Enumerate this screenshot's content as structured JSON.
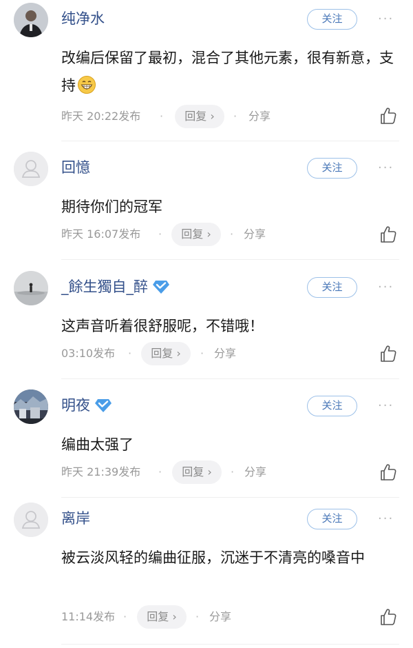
{
  "follow_label": "关注",
  "more_glyph": "···",
  "share_label": "分享",
  "dot": "·",
  "colors": {
    "username": "#33508a",
    "follow_border": "#9cc0e8",
    "follow_text": "#4a78b8",
    "meta_text": "#999999",
    "reply_bg": "#f2f2f4",
    "verified": "#4a9de8"
  },
  "comments": [
    {
      "username": "纯净水",
      "verified": false,
      "avatar": "person-in-dark-jacket",
      "text": "改编后保留了最初，混合了其他元素，很有新意，支持",
      "emoji": "grinning-face-emoji",
      "time": "昨天 20:22发布",
      "reply": "回复 ›"
    },
    {
      "username": "回憶",
      "verified": false,
      "avatar": "default-gray-avatar",
      "text": "期待你们的冠军",
      "time": "昨天 16:07发布",
      "reply": "回复 ›"
    },
    {
      "username": "_餘生獨自_醉",
      "verified": true,
      "avatar": "figure-in-fog",
      "text": "这声音听着很舒服呢，不错哦！",
      "time": "03:10发布",
      "reply": "回复 ›"
    },
    {
      "username": "明夜",
      "verified": true,
      "avatar": "night-scene",
      "text": "编曲太强了",
      "time": "昨天 21:39发布",
      "reply": "回复 ›"
    },
    {
      "username": "离岸",
      "verified": false,
      "avatar": "default-gray-avatar",
      "text": "被云淡风轻的编曲征服，沉迷于不清亮的嗓音中",
      "time": "11:14发布",
      "reply": "回复 ›"
    }
  ]
}
